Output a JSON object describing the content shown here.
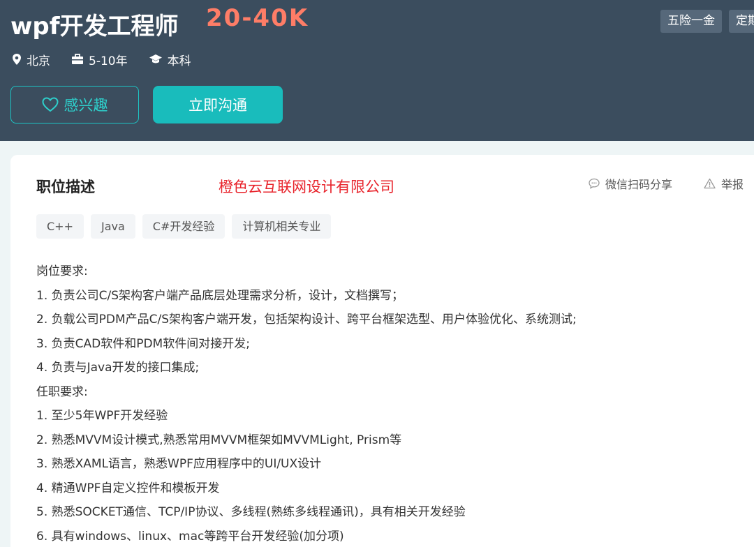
{
  "header": {
    "title": "wpf开发工程师",
    "salary": "20-40K",
    "benefits": [
      "五险一金",
      "定期"
    ],
    "meta": {
      "location": "北京",
      "experience": "5-10年",
      "education": "本科"
    },
    "interest_label": "感兴趣",
    "chat_label": "立即沟通"
  },
  "content": {
    "section_title": "职位描述",
    "company": "橙色云互联网设计有限公司",
    "share_label": "微信扫码分享",
    "report_label": "举报",
    "tags": [
      "C++",
      "Java",
      "C#开发经验",
      "计算机相关专业"
    ],
    "lines": [
      "岗位要求:",
      "1. 负责公司C/S架构客户端产品底层处理需求分析，设计，文档撰写；",
      "2. 负载公司PDM产品C/S架构客户端开发，包括架构设计、跨平台框架选型、用户体验优化、系统测试;",
      "3. 负责CAD软件和PDM软件间对接开发;",
      "4. 负责与Java开发的接口集成;",
      "任职要求:",
      "1.  至少5年WPF开发经验",
      "2.  熟悉MVVM设计模式,熟悉常用MVVM框架如MVVMLight, Prism等",
      "3.  熟悉XAML语言，熟悉WPF应用程序中的UI/UX设计",
      "4.  精通WPF自定义控件和模板开发",
      "5.  熟悉SOCKET通信、TCP/IP协议、多线程(熟练多线程通讯)，具有相关开发经验",
      "6.  具有windows、linux、mac等跨平台开发经验(加分项)"
    ]
  },
  "colors": {
    "header_bg": "#3b4d5e",
    "salary": "#fe7d67",
    "accent": "#19bcbc",
    "company": "#e8232b"
  }
}
